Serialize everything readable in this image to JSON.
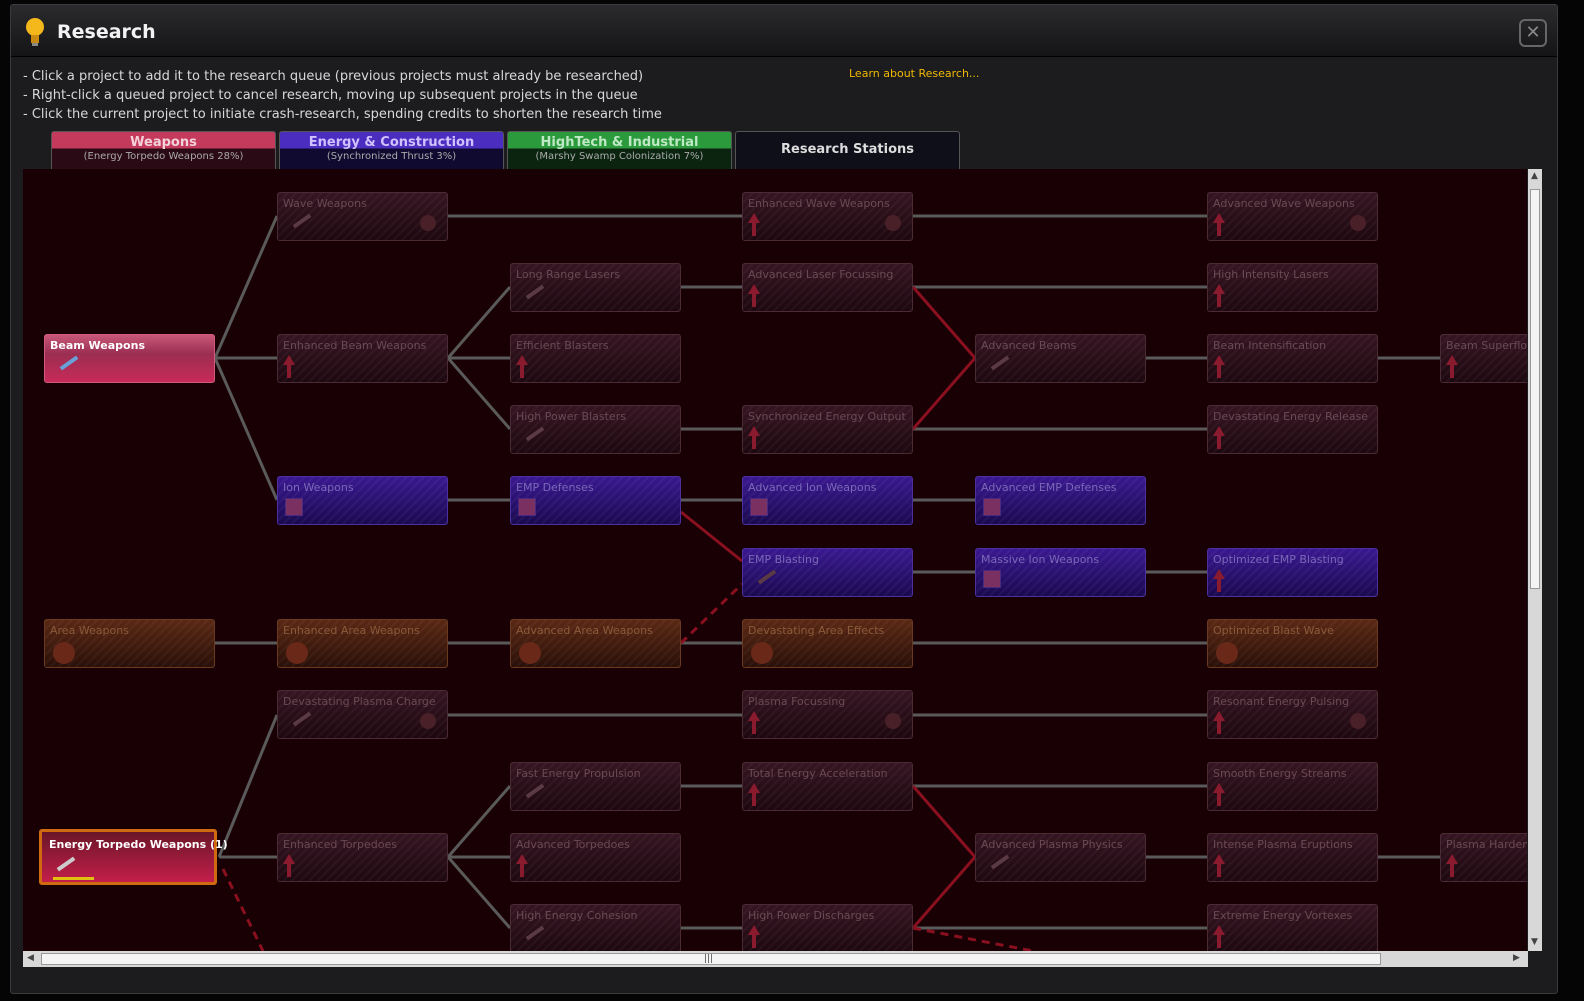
{
  "window": {
    "title": "Research",
    "close_label": "✕"
  },
  "instructions": [
    "- Click a project to add it to the research queue (previous projects must already be researched)",
    "- Right-click a queued project to cancel research, moving up subsequent projects in the queue",
    "- Click the current project to initiate crash-research, spending credits to shorten the research time"
  ],
  "learn_link": "Learn about Research...",
  "tabs": [
    {
      "label": "Weapons",
      "sub": "(Energy Torpedo Weapons 28%)",
      "color": "#c43a5c"
    },
    {
      "label": "Energy & Construction",
      "sub": "(Synchronized Thrust 3%)",
      "color": "#4b2ec0"
    },
    {
      "label": "HighTech & Industrial",
      "sub": "(Marshy Swamp Colonization 7%)",
      "color": "#2a9a3c"
    },
    {
      "label": "Research Stations",
      "sub": "",
      "color": "#0f0f1a"
    }
  ],
  "nodes": {
    "beam_weapons": "Beam Weapons",
    "wave_weapons": "Wave Weapons",
    "enhanced_wave_weapons": "Enhanced Wave Weapons",
    "advanced_wave_weapons": "Advanced Wave Weapons",
    "long_range_lasers": "Long Range Lasers",
    "advanced_laser_focussing": "Advanced Laser Focussing",
    "high_intensity_lasers": "High Intensity Lasers",
    "enhanced_beam_weapons": "Enhanced Beam Weapons",
    "efficient_blasters": "Efficient Blasters",
    "advanced_beams": "Advanced Beams",
    "beam_intensification": "Beam Intensification",
    "beam_superflow": "Beam Superflow",
    "high_power_blasters": "High Power Blasters",
    "synchronized_energy_output": "Synchronized Energy Output",
    "devastating_energy_release": "Devastating Energy Release",
    "ion_weapons": "Ion Weapons",
    "emp_defenses": "EMP Defenses",
    "advanced_ion_weapons": "Advanced Ion Weapons",
    "advanced_emp_defenses": "Advanced EMP Defenses",
    "emp_blasting": "EMP Blasting",
    "massive_ion_weapons": "Massive Ion Weapons",
    "optimized_emp_blasting": "Optimized EMP Blasting",
    "area_weapons": "Area Weapons",
    "enhanced_area_weapons": "Enhanced Area Weapons",
    "advanced_area_weapons": "Advanced Area Weapons",
    "devastating_area_effects": "Devastating Area Effects",
    "optimized_blast_wave": "Optimized Blast Wave",
    "devastating_plasma_charge": "Devastating Plasma Charge",
    "plasma_focussing": "Plasma Focussing",
    "resonant_energy_pulsing": "Resonant Energy Pulsing",
    "fast_energy_propulsion": "Fast Energy Propulsion",
    "total_energy_acceleration": "Total Energy Acceleration",
    "smooth_energy_streams": "Smooth Energy Streams",
    "energy_torpedo_weapons": "Energy Torpedo Weapons (1)",
    "energy_torpedo_progress": 0.28,
    "enhanced_torpedoes": "Enhanced Torpedoes",
    "advanced_torpedoes": "Advanced Torpedoes",
    "advanced_plasma_physics": "Advanced Plasma Physics",
    "intense_plasma_eruptions": "Intense Plasma Eruptions",
    "plasma_hardening": "Plasma Hardening",
    "high_energy_cohesion": "High Energy Cohesion",
    "high_power_discharges": "High Power Discharges",
    "extreme_energy_vortexes": "Extreme Energy Vortexes"
  },
  "colors": {
    "link": "#5a5a5a",
    "link_red": "#8a1020",
    "active_border": "#d06a10",
    "progress": "#e0c010"
  },
  "scrollbar": {
    "up": "▲",
    "down": "▼",
    "left": "◀",
    "right": "▶",
    "grip": "|||"
  }
}
